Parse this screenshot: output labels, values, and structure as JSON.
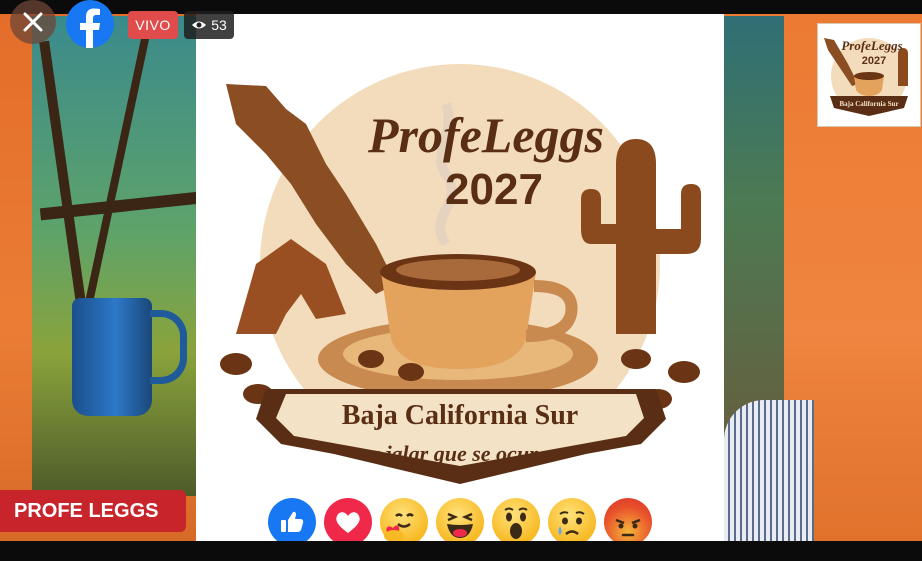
{
  "stream": {
    "close_icon": "close-icon",
    "platform_icon": "facebook-icon",
    "live_label": "VIVO",
    "viewer_count": "53",
    "viewer_icon": "eye-icon"
  },
  "overlay": {
    "name_banner": "PROFE LEGGS"
  },
  "poster": {
    "title_line1": "ProfeLeggs",
    "title_line2": "2027",
    "ribbon_line1": "Baja California Sur",
    "ribbon_line2": "a jalar que se ocupa"
  },
  "thumbnail": {
    "title_line1": "ProfeLeggs",
    "title_line2": "2027",
    "ribbon_line1": "Baja California Sur"
  },
  "reactions": [
    {
      "name": "like",
      "icon": "thumbs-up-icon"
    },
    {
      "name": "love",
      "icon": "heart-icon"
    },
    {
      "name": "care",
      "icon": "care-emoji-icon"
    },
    {
      "name": "haha",
      "icon": "laughing-emoji-icon"
    },
    {
      "name": "wow",
      "icon": "wow-emoji-icon"
    },
    {
      "name": "sad",
      "icon": "sad-emoji-icon"
    },
    {
      "name": "angry",
      "icon": "angry-emoji-icon"
    }
  ],
  "colors": {
    "facebook_blue": "#1877f2",
    "live_red": "#e04c4c",
    "banner_red": "#c8242b",
    "poster_brown": "#5a2e14"
  }
}
